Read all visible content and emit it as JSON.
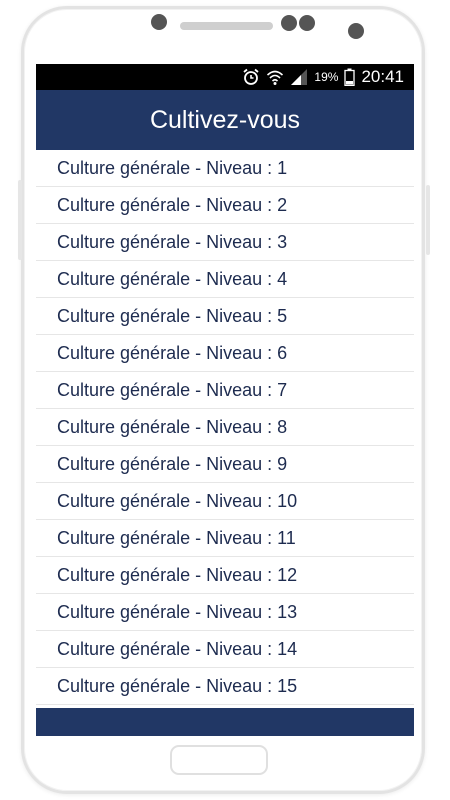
{
  "status": {
    "battery_percent": "19%",
    "time": "20:41",
    "icons": [
      "alarm-icon",
      "wifi-icon",
      "signal-icon",
      "battery-icon"
    ]
  },
  "appbar": {
    "title": "Cultivez-vous"
  },
  "list": {
    "items": [
      {
        "label": "Culture générale - Niveau : 1"
      },
      {
        "label": "Culture générale - Niveau : 2"
      },
      {
        "label": "Culture générale - Niveau : 3"
      },
      {
        "label": "Culture générale - Niveau : 4"
      },
      {
        "label": "Culture générale - Niveau : 5"
      },
      {
        "label": "Culture générale - Niveau : 6"
      },
      {
        "label": "Culture générale - Niveau : 7"
      },
      {
        "label": "Culture générale - Niveau : 8"
      },
      {
        "label": "Culture générale - Niveau : 9"
      },
      {
        "label": "Culture générale - Niveau : 10"
      },
      {
        "label": "Culture générale - Niveau : 11"
      },
      {
        "label": "Culture générale - Niveau : 12"
      },
      {
        "label": "Culture générale - Niveau : 13"
      },
      {
        "label": "Culture générale - Niveau : 14"
      },
      {
        "label": "Culture générale - Niveau : 15"
      }
    ]
  },
  "colors": {
    "primary": "#213765",
    "item_text": "#1d2b4f",
    "divider": "#e6e6e6"
  }
}
